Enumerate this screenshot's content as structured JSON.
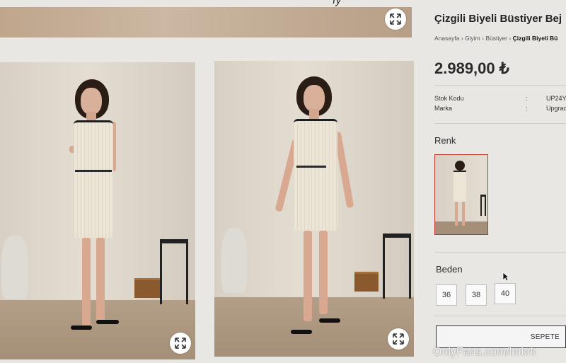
{
  "header_fragment": "fy",
  "product": {
    "title": "Çizgili Biyeli Büstiyer Bej",
    "breadcrumb": [
      "Anasayfa",
      "Giyim",
      "Büstiyer",
      "Çizgili Biyeli Bü"
    ],
    "price": "2.989,00 ₺",
    "specs": [
      {
        "label": "Stok Kodu",
        "sep": ":",
        "value": "UP24Y"
      },
      {
        "label": "Marka",
        "sep": ":",
        "value": "Upgrad"
      }
    ]
  },
  "color_section": {
    "title": "Renk"
  },
  "size_section": {
    "title": "Beden",
    "sizes": [
      "36",
      "38",
      "40"
    ]
  },
  "cart": {
    "label": "SEPETE"
  },
  "watermark": "OnlyFans.com/lmkrk",
  "colors": {
    "accent_border": "#c0392b",
    "price": "#2a2a2a",
    "background": "#e9e7e4"
  },
  "icons": {
    "zoom": "expand-arrows-icon",
    "cursor": "mouse-pointer-icon"
  }
}
